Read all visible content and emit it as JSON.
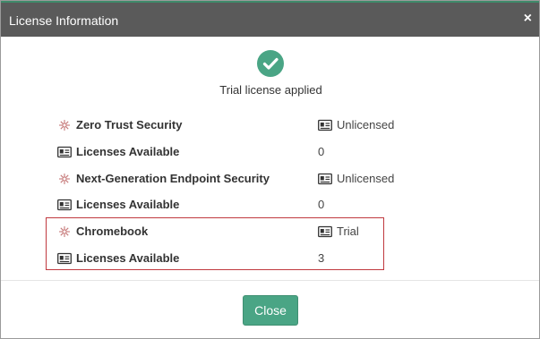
{
  "dialog": {
    "title": "License Information",
    "close_glyph": "×",
    "status_icon": "check-circle-icon",
    "status_text": "Trial license applied",
    "close_button_label": "Close"
  },
  "colors": {
    "header_bg": "#5a5a5a",
    "accent_green": "#4aa585",
    "highlight_border": "#c0393f"
  },
  "rows": [
    {
      "icon": "product-icon",
      "label": "Zero Trust Security",
      "value_icon": "license-card-icon",
      "value": "Unlicensed"
    },
    {
      "icon": "license-card-icon",
      "label": "Licenses Available",
      "value": "0"
    },
    {
      "icon": "product-icon",
      "label": "Next-Generation Endpoint Security",
      "value_icon": "license-card-icon",
      "value": "Unlicensed"
    },
    {
      "icon": "license-card-icon",
      "label": "Licenses Available",
      "value": "0"
    },
    {
      "icon": "product-icon",
      "label": "Chromebook",
      "value_icon": "license-card-icon",
      "value": "Trial"
    },
    {
      "icon": "license-card-icon",
      "label": "Licenses Available",
      "value": "3"
    }
  ]
}
